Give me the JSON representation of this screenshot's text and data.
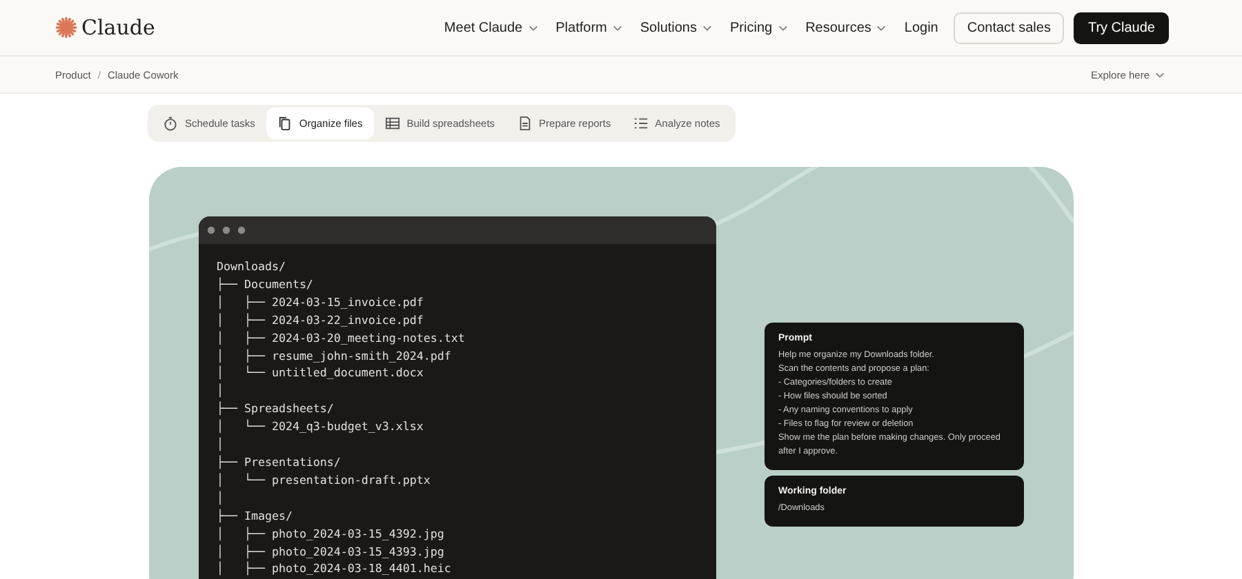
{
  "header": {
    "logo": "Claude",
    "nav": [
      {
        "label": "Meet Claude",
        "dropdown": true
      },
      {
        "label": "Platform",
        "dropdown": true
      },
      {
        "label": "Solutions",
        "dropdown": true
      },
      {
        "label": "Pricing",
        "dropdown": true
      },
      {
        "label": "Resources",
        "dropdown": true
      },
      {
        "label": "Login",
        "dropdown": false
      }
    ],
    "contact_button": "Contact sales",
    "try_button": "Try Claude"
  },
  "breadcrumb": {
    "items": [
      "Product",
      "Claude Cowork"
    ],
    "separator": "/",
    "explore": "Explore here"
  },
  "tabs": [
    {
      "label": "Schedule tasks",
      "selected": false
    },
    {
      "label": "Organize files",
      "selected": true
    },
    {
      "label": "Build spreadsheets",
      "selected": false
    },
    {
      "label": "Prepare reports",
      "selected": false
    },
    {
      "label": "Analyze notes",
      "selected": false
    }
  ],
  "terminal": {
    "lines": [
      "Downloads/",
      "├── Documents/",
      "│   ├── 2024-03-15_invoice.pdf",
      "│   ├── 2024-03-22_invoice.pdf",
      "│   ├── 2024-03-20_meeting-notes.txt",
      "│   ├── resume_john-smith_2024.pdf",
      "│   └── untitled_document.docx",
      "│",
      "├── Spreadsheets/",
      "│   └── 2024_q3-budget_v3.xlsx",
      "│",
      "├── Presentations/",
      "│   └── presentation-draft.pptx",
      "│",
      "├── Images/",
      "│   ├── photo_2024-03-15_4392.jpg",
      "│   ├── photo_2024-03-15_4393.jpg",
      "│   ├── photo_2024-03-18_4401.heic"
    ]
  },
  "cards": [
    {
      "title": "Prompt",
      "lines": [
        "Help me organize my Downloads folder.",
        "Scan the contents and propose a plan:",
        "- Categories/folders to create",
        "- How files should be sorted",
        "- Any naming conventions to apply",
        "- Files to flag for review or deletion",
        "Show me the plan before making changes. Only proceed after I approve."
      ]
    },
    {
      "title": "Working folder",
      "lines": [
        "/Downloads"
      ]
    }
  ]
}
